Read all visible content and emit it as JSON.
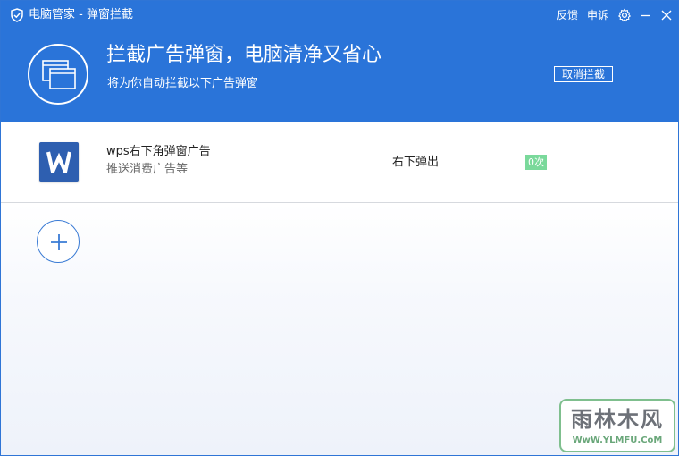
{
  "window": {
    "title": "电脑管家 - 弹窗拦截",
    "links": {
      "feedback": "反馈",
      "complaint": "申诉"
    },
    "icons": [
      "shield-logo-icon",
      "gear-icon",
      "minimize-icon",
      "close-icon"
    ]
  },
  "header": {
    "headline": "拦截广告弹窗，电脑清净又省心",
    "subline": "将为你自动拦截以下广告弹窗",
    "cancel_button": "取消拦截",
    "icon": "popup-window-icon",
    "background_color": "#2a74d9"
  },
  "rules": [
    {
      "name": "wps右下角弹窗广告",
      "description": "推送消费广告等",
      "position": "右下弹出",
      "count": "0次",
      "icon": "wps-icon"
    }
  ],
  "add_button": {
    "icon": "plus-icon"
  },
  "watermark": {
    "title": "雨林木风",
    "url": "WwW.YLMFU.CoM"
  }
}
